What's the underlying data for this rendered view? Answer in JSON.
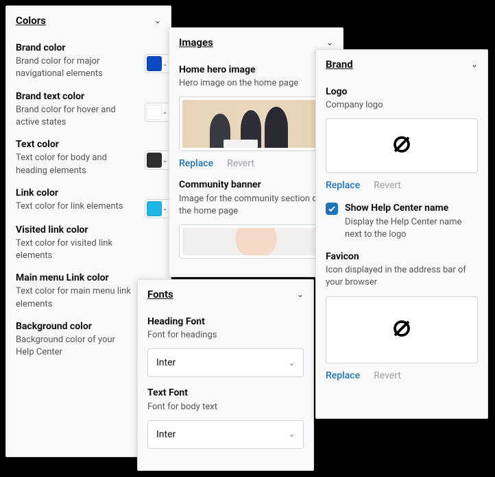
{
  "colors": {
    "heading": "Colors",
    "items": [
      {
        "title": "Brand color",
        "desc": "Brand color for major navigational elements",
        "swatch": "#0a4bc4"
      },
      {
        "title": "Brand text color",
        "desc": "Brand color for hover and active states",
        "swatch": "#ffffff"
      },
      {
        "title": "Text color",
        "desc": "Text color for body and heading elements",
        "swatch": "#2f2f2f"
      },
      {
        "title": "Link color",
        "desc": "Text color for link elements",
        "swatch": "#1fb6e6"
      },
      {
        "title": "Visited link color",
        "desc": "Text color for visited link elements",
        "swatch": null
      },
      {
        "title": "Main menu Link color",
        "desc": "Text color for main menu link elements",
        "swatch": null
      },
      {
        "title": "Background color",
        "desc": "Background color of your Help Center",
        "swatch": null
      }
    ]
  },
  "images": {
    "heading": "Images",
    "hero": {
      "title": "Home hero image",
      "desc": "Hero image on the home page"
    },
    "community": {
      "title": "Community banner",
      "desc": "Image for the community section on the home page"
    },
    "replace": "Replace",
    "revert": "Revert"
  },
  "fonts": {
    "heading": "Fonts",
    "heading_font": {
      "title": "Heading Font",
      "desc": "Font for headings",
      "value": "Inter"
    },
    "text_font": {
      "title": "Text Font",
      "desc": "Font for body text",
      "value": "Inter"
    }
  },
  "brand": {
    "heading": "Brand",
    "logo": {
      "title": "Logo",
      "desc": "Company logo"
    },
    "show_name": {
      "title": "Show Help Center name",
      "desc": "Display the Help Center name next to the logo"
    },
    "favicon": {
      "title": "Favicon",
      "desc": "Icon displayed in the address bar of your browser"
    },
    "replace": "Replace",
    "revert": "Revert"
  }
}
